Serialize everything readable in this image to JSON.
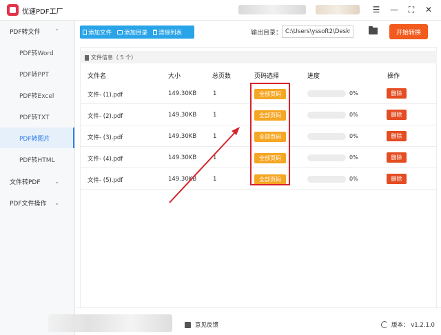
{
  "app": {
    "title": "优速PDF工厂"
  },
  "window_controls": {
    "menu": "☰",
    "minimize": "—",
    "restore": "⛶",
    "close": "✕"
  },
  "sidebar": {
    "groups": [
      {
        "label": "PDF转文件",
        "chevron": "⌃"
      },
      {
        "label": "文件转PDF",
        "chevron": "⌄"
      },
      {
        "label": "PDF文件操作",
        "chevron": "⌄"
      }
    ],
    "items": [
      {
        "label": "PDF转Word"
      },
      {
        "label": "PDF转PPT"
      },
      {
        "label": "PDF转Excel"
      },
      {
        "label": "PDF转TXT"
      },
      {
        "label": "PDF转图片",
        "active": true
      },
      {
        "label": "PDF转HTML"
      }
    ]
  },
  "toolbar": {
    "add_file": "添加文件",
    "add_dir": "添加目录",
    "clear_list": "清除列表"
  },
  "output": {
    "label": "输出目录：",
    "path": "C:\\Users\\yssoft2\\Deskt"
  },
  "start_button": "开始转换",
  "file_info": "文件信息（ 5 个）",
  "table": {
    "headers": [
      "文件名",
      "大小",
      "总页数",
      "页码选择",
      "进度",
      "操作"
    ],
    "rows": [
      {
        "name": "文件- (1).pdf",
        "size": "149.30KB",
        "pages": "1",
        "page_select": "全部页码",
        "progress": 0,
        "progress_text": "0%",
        "action": "删除"
      },
      {
        "name": "文件- (2).pdf",
        "size": "149.30KB",
        "pages": "1",
        "page_select": "全部页码",
        "progress": 0,
        "progress_text": "0%",
        "action": "删除"
      },
      {
        "name": "文件- (3).pdf",
        "size": "149.30KB",
        "pages": "1",
        "page_select": "全部页码",
        "progress": 0,
        "progress_text": "0%",
        "action": "删除"
      },
      {
        "name": "文件- (4).pdf",
        "size": "149.30KB",
        "pages": "1",
        "page_select": "全部页码",
        "progress": 0,
        "progress_text": "0%",
        "action": "删除"
      },
      {
        "name": "文件- (5).pdf",
        "size": "149.30KB",
        "pages": "1",
        "page_select": "全部页码",
        "progress": 0,
        "progress_text": "0%",
        "action": "删除"
      }
    ]
  },
  "footer": {
    "feedback": "意见反馈",
    "version": "版本： v1.2.1.0"
  },
  "colors": {
    "accent_blue": "#2aa4e8",
    "start_orange": "#f25a1e",
    "page_btn_orange": "#f5a623",
    "delete_red": "#e44c22",
    "annotation_red": "#d6222a"
  }
}
